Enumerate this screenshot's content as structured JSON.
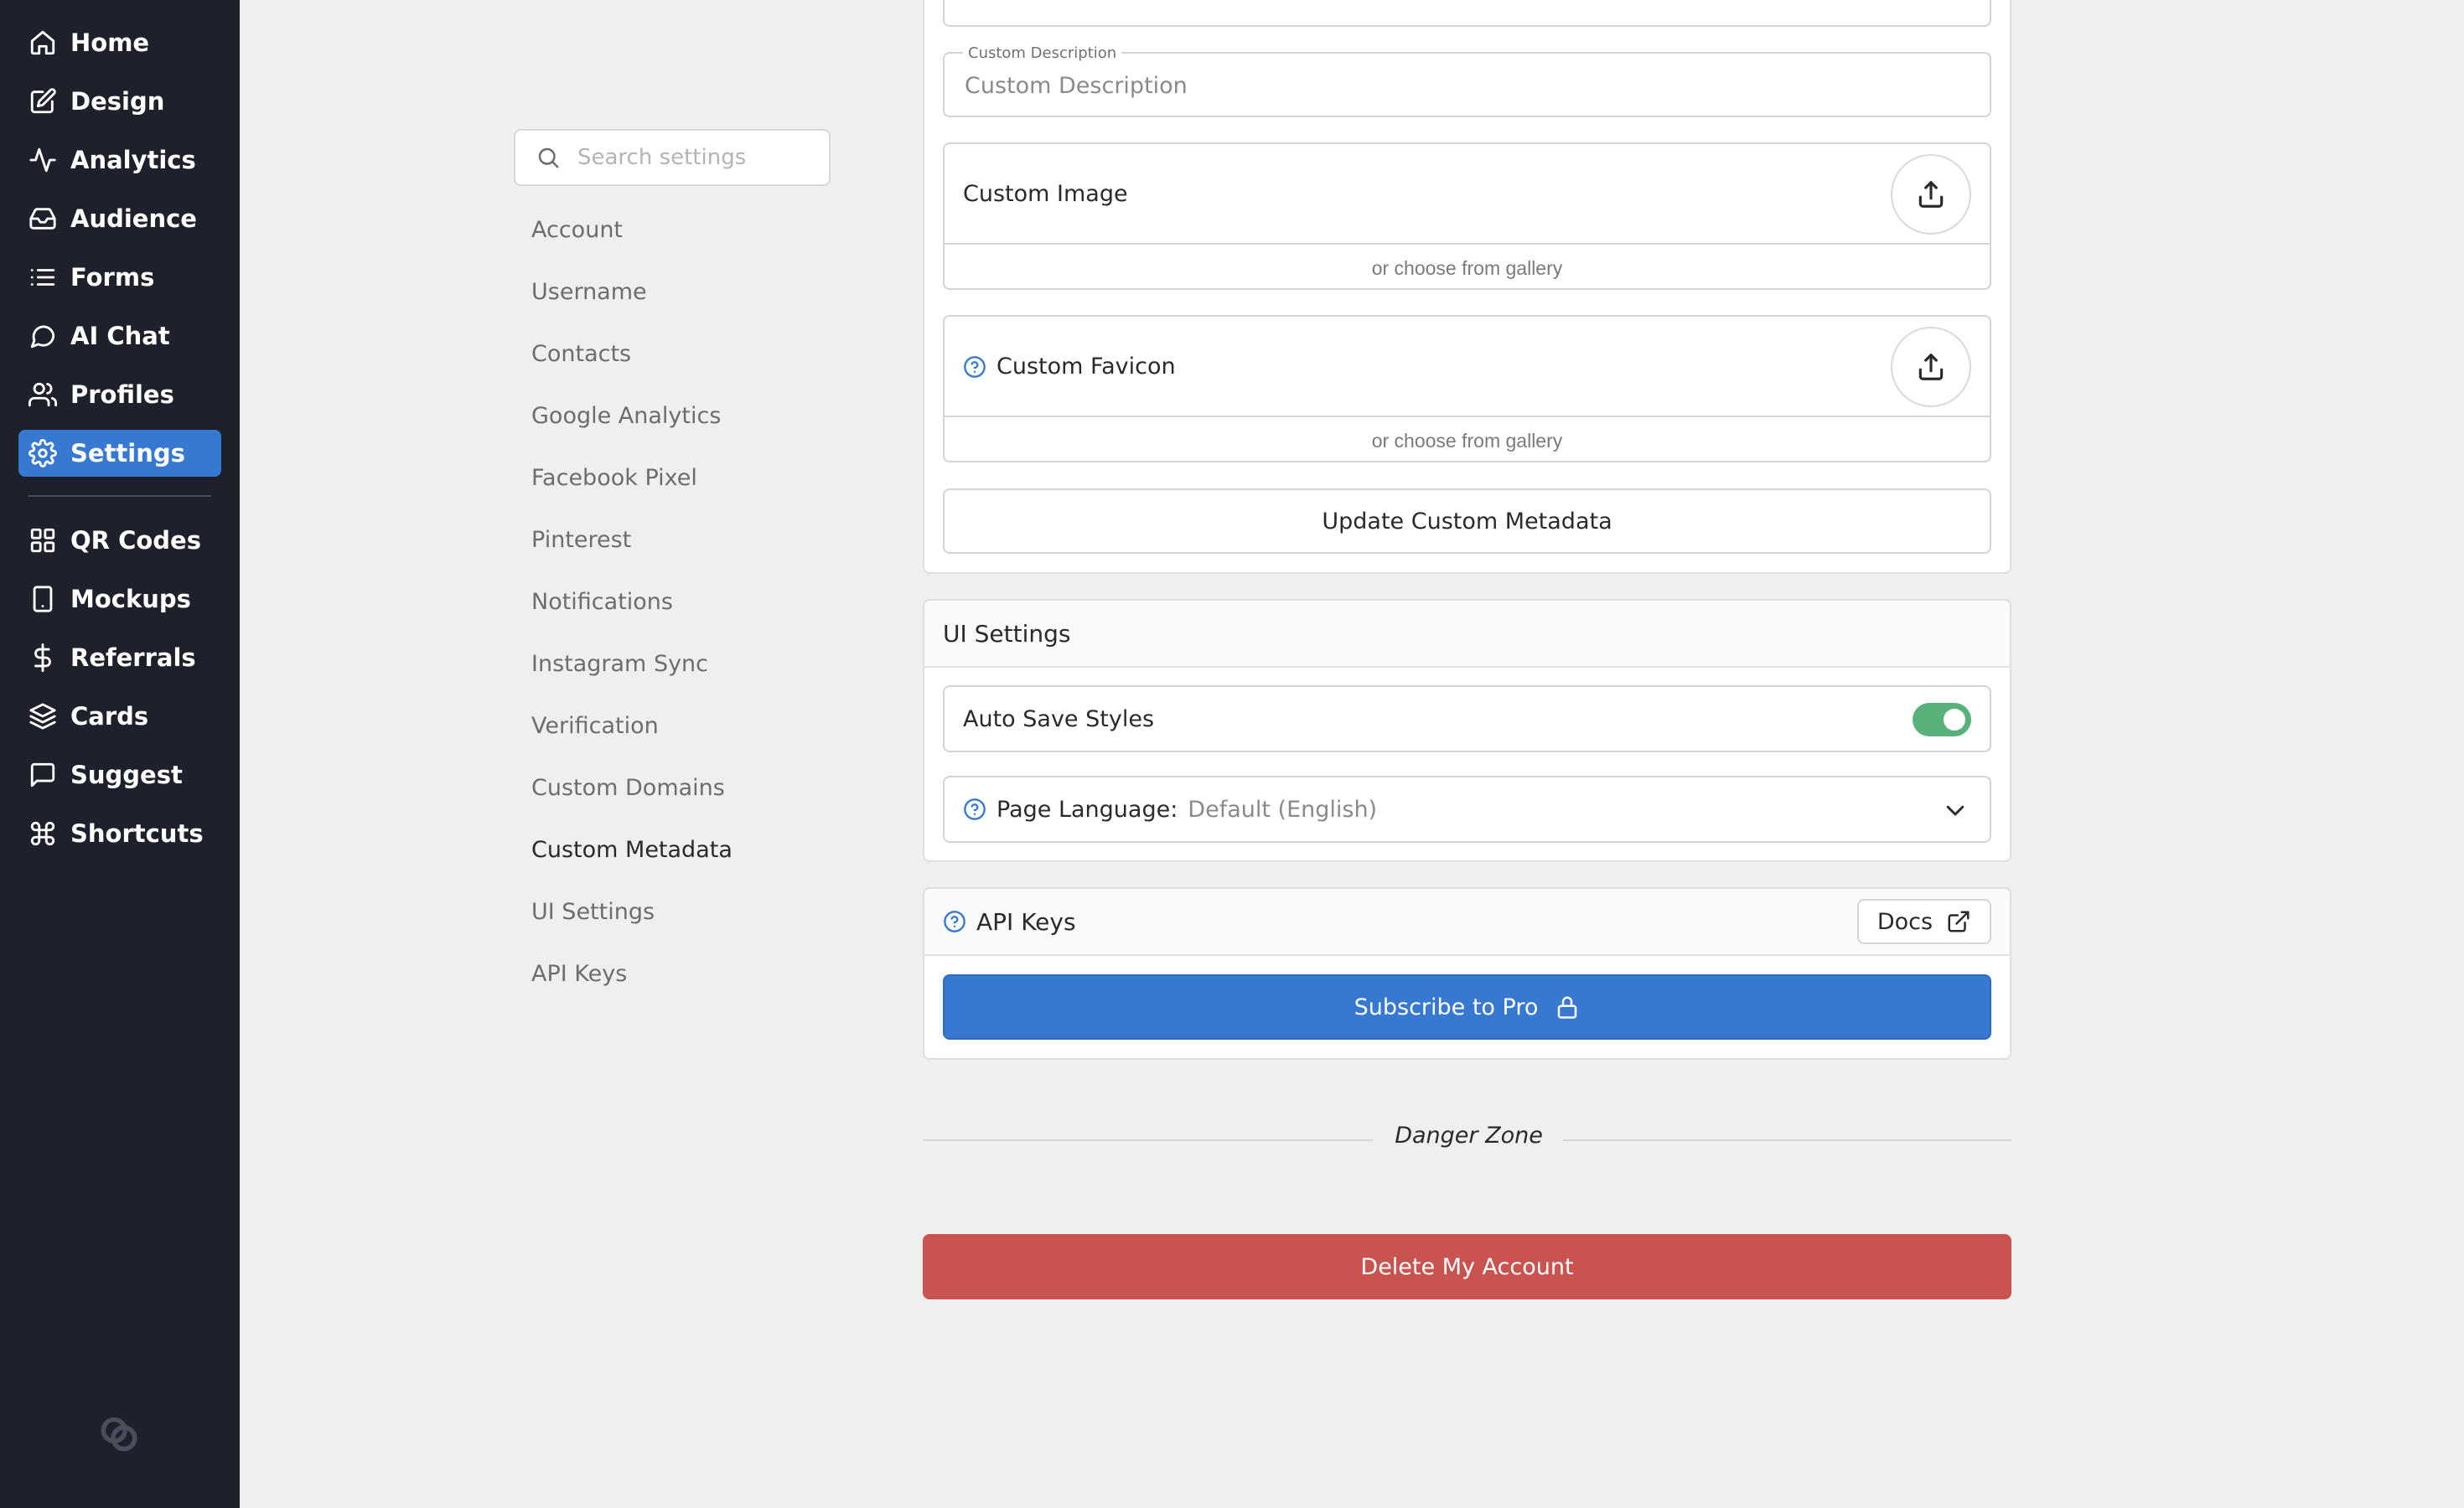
{
  "sidebar": {
    "items": [
      {
        "label": "Home",
        "icon": "home-icon"
      },
      {
        "label": "Design",
        "icon": "edit-icon"
      },
      {
        "label": "Analytics",
        "icon": "activity-icon"
      },
      {
        "label": "Audience",
        "icon": "inbox-icon"
      },
      {
        "label": "Forms",
        "icon": "list-icon"
      },
      {
        "label": "AI Chat",
        "icon": "chat-bubble-icon"
      },
      {
        "label": "Profiles",
        "icon": "users-icon"
      },
      {
        "label": "Settings",
        "icon": "gear-icon",
        "active": true
      },
      {
        "label": "QR Codes",
        "icon": "grid-icon"
      },
      {
        "label": "Mockups",
        "icon": "phone-icon"
      },
      {
        "label": "Referrals",
        "icon": "dollar-icon"
      },
      {
        "label": "Cards",
        "icon": "layers-icon"
      },
      {
        "label": "Suggest",
        "icon": "message-square-icon"
      },
      {
        "label": "Shortcuts",
        "icon": "command-icon"
      }
    ],
    "accent": "#3778d0"
  },
  "settings_nav": {
    "search_placeholder": "Search settings",
    "items": [
      {
        "label": "Account"
      },
      {
        "label": "Username"
      },
      {
        "label": "Contacts"
      },
      {
        "label": "Google Analytics"
      },
      {
        "label": "Facebook Pixel"
      },
      {
        "label": "Pinterest"
      },
      {
        "label": "Notifications"
      },
      {
        "label": "Instagram Sync"
      },
      {
        "label": "Verification"
      },
      {
        "label": "Custom Domains"
      },
      {
        "label": "Custom Metadata",
        "active": true
      },
      {
        "label": "UI Settings"
      },
      {
        "label": "API Keys"
      }
    ]
  },
  "custom_metadata": {
    "description_label": "Custom Description",
    "description_placeholder": "Custom Description",
    "image_label": "Custom Image",
    "favicon_label": "Custom Favicon",
    "gallery_link": "or choose from gallery",
    "update_button": "Update Custom Metadata"
  },
  "ui_settings": {
    "title": "UI Settings",
    "auto_save_label": "Auto Save Styles",
    "auto_save_enabled": true,
    "language_label": "Page Language:",
    "language_value": "Default (English)"
  },
  "api_keys": {
    "title": "API Keys",
    "docs_button": "Docs",
    "subscribe_button": "Subscribe to Pro"
  },
  "danger_zone": {
    "title": "Danger Zone",
    "delete_button": "Delete My Account",
    "color": "#c9534f"
  }
}
